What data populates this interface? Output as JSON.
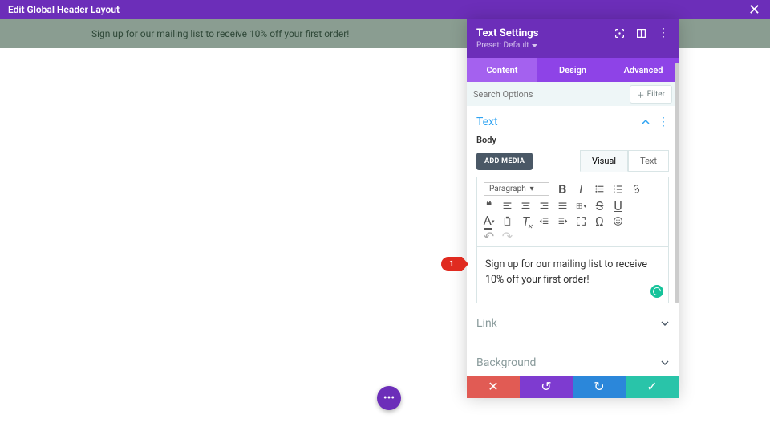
{
  "top": {
    "title": "Edit Global Header Layout"
  },
  "strip": {
    "text": "Sign up for our mailing list to receive  10% off your first order!"
  },
  "panel": {
    "title": "Text Settings",
    "preset": "Preset: Default",
    "tabs": [
      "Content",
      "Design",
      "Advanced"
    ],
    "search_placeholder": "Search Options",
    "filter_label": "Filter",
    "section_text": "Text",
    "body_label": "Body",
    "add_media": "ADD MEDIA",
    "visual_tab": "Visual",
    "text_tab": "Text",
    "paragraph_label": "Paragraph",
    "editor_content": "Sign up for our mailing list to receive  10% off your first order!",
    "link_label": "Link",
    "background_label": "Background"
  },
  "callout": {
    "num": "1"
  }
}
